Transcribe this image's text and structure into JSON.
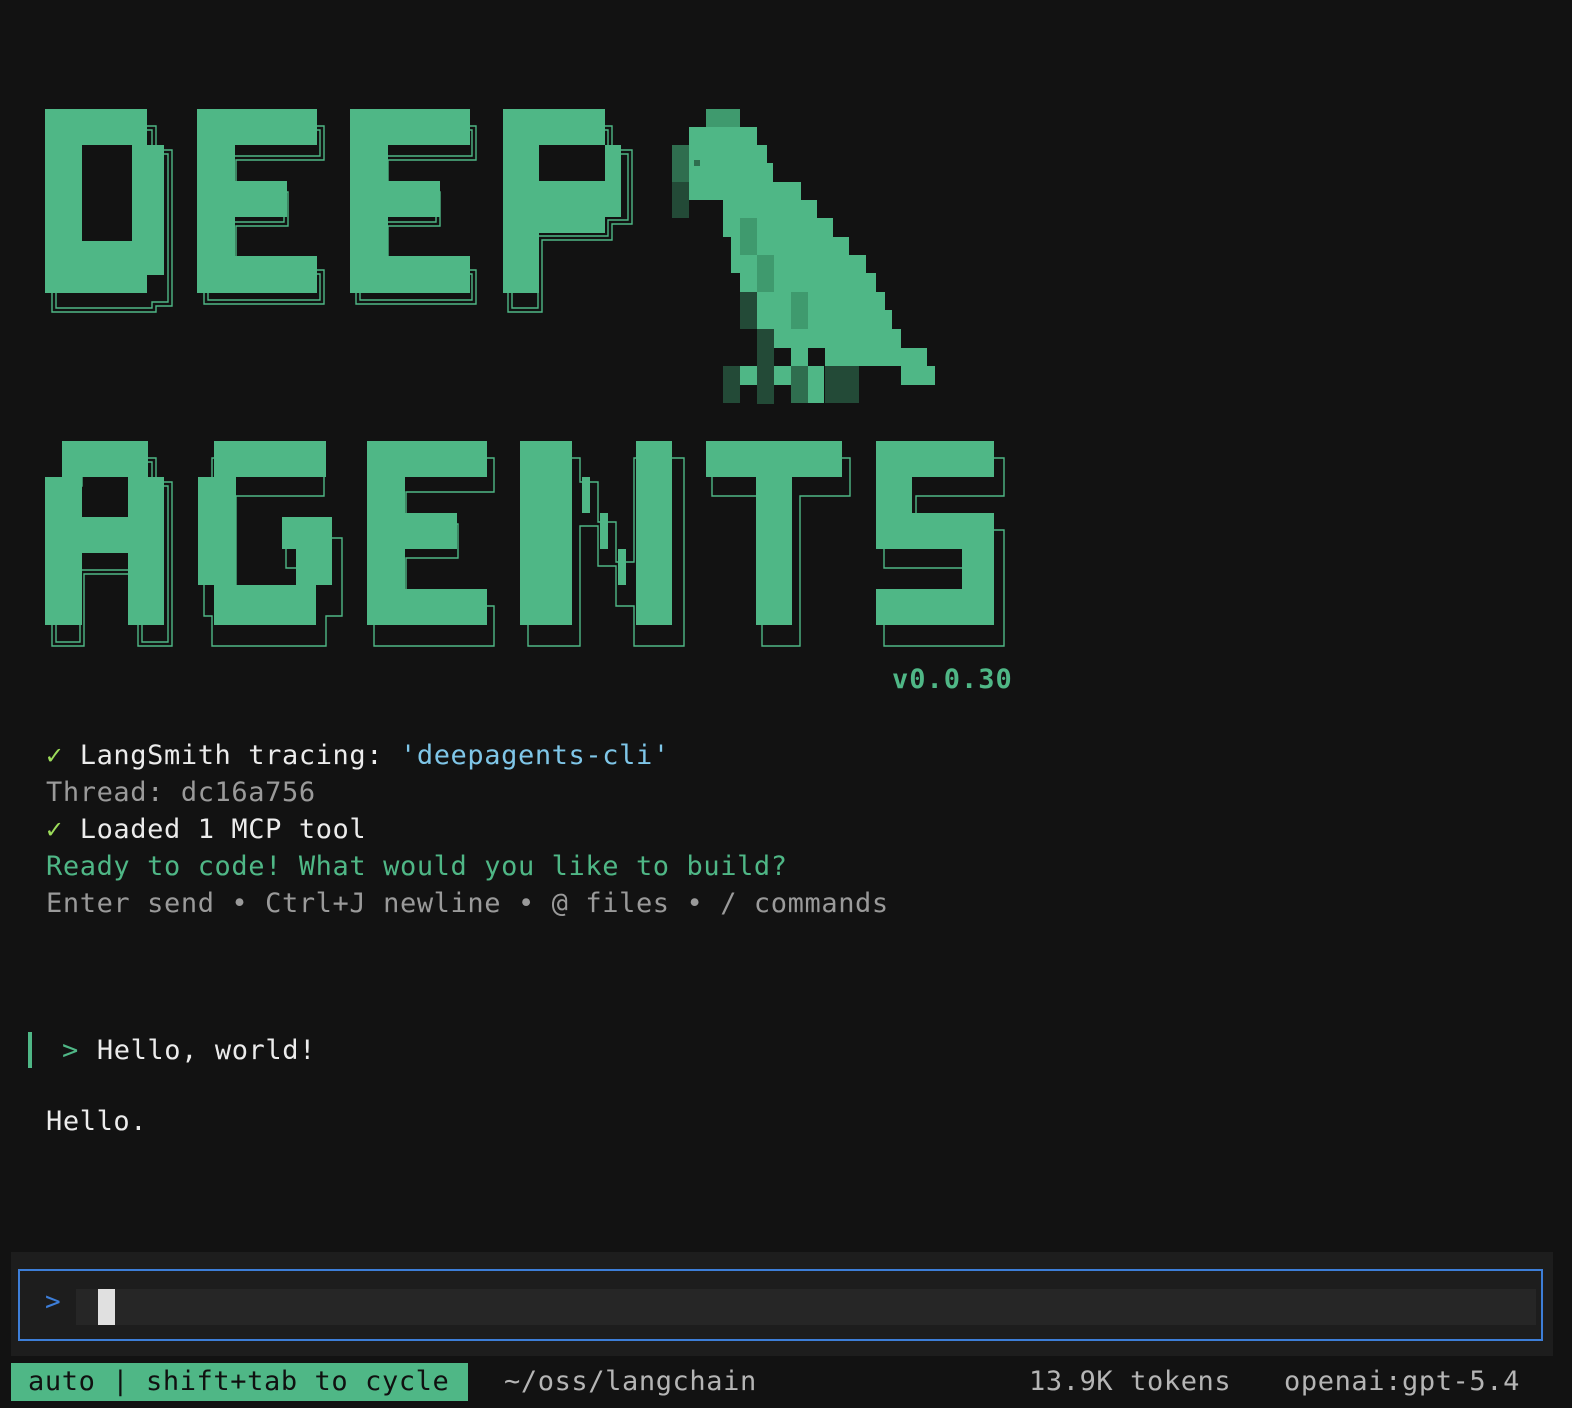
{
  "app": {
    "logo_text": [
      "DEEP",
      "AGENTS"
    ],
    "version": "v0.0.30"
  },
  "status": {
    "check_glyph": "✓",
    "tracing_label": "LangSmith tracing: ",
    "tracing_project": "'deepagents-cli'",
    "thread": "Thread: dc16a756",
    "mcp_loaded": "Loaded 1 MCP tool",
    "ready": "Ready to code! What would you like to build?",
    "hints": "Enter send • Ctrl+J newline • @ files • / commands"
  },
  "conversation": {
    "user_prompt_glyph": ">",
    "user_message": "Hello, world!",
    "assistant_reply": "Hello."
  },
  "input": {
    "prompt_glyph": ">",
    "value": ""
  },
  "footer": {
    "mode": "auto | shift+tab to cycle",
    "cwd": "~/oss/langchain",
    "tokens": "13.9K tokens",
    "model": "openai:gpt-5.4"
  },
  "colors": {
    "accent_green": "#4fb786",
    "check_green": "#9cdc5a",
    "link_cyan": "#7fc6e8",
    "input_border_blue": "#3d7ed8",
    "background": "#121212"
  }
}
